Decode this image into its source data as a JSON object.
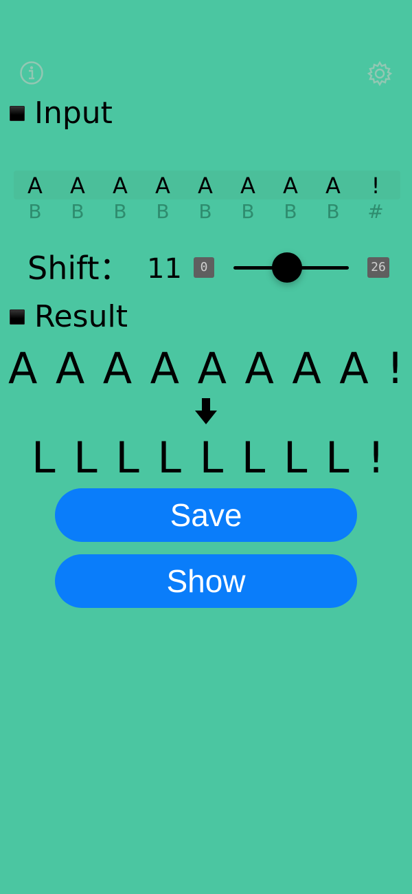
{
  "sections": {
    "input_title": "Input",
    "result_title": "Result"
  },
  "input": {
    "top_chars": [
      "A",
      "A",
      "A",
      "A",
      "A",
      "A",
      "A",
      "A",
      "!"
    ],
    "bottom_chars": [
      "B",
      "B",
      "B",
      "B",
      "B",
      "B",
      "B",
      "B",
      "#"
    ]
  },
  "shift": {
    "label": "Shift：",
    "value": "11",
    "min_label": "0",
    "max_label": "26",
    "position_fraction": 0.423
  },
  "result": {
    "source_chars": [
      "A",
      "A",
      "A",
      "A",
      "A",
      "A",
      "A",
      "A",
      "!"
    ],
    "output_chars": [
      "L",
      "L",
      "L",
      "L",
      "L",
      "L",
      "L",
      "L",
      "!"
    ]
  },
  "buttons": {
    "save_label": "Save",
    "show_label": "Show"
  },
  "icons": {
    "top_left": "info-icon",
    "top_right": "gear-icon",
    "arrow": "arrow-down-icon"
  },
  "colors": {
    "background": "#4BC6A1",
    "button": "#0A7DFA",
    "input_bottom_text": "#2e8c6e",
    "badge": "#5f5f5f"
  }
}
